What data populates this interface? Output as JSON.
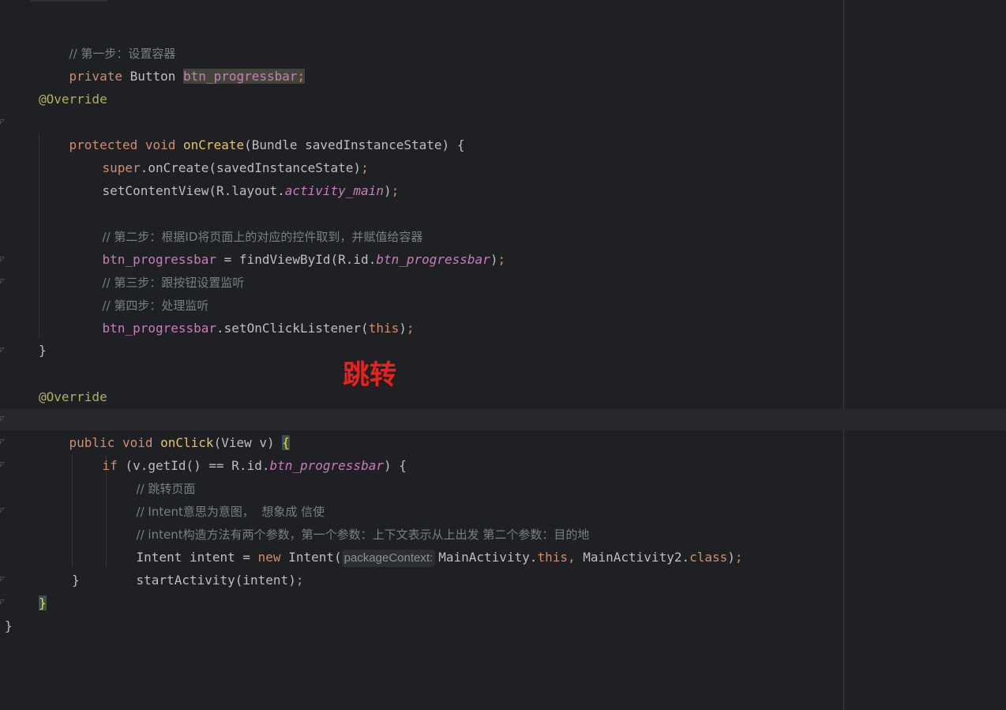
{
  "lines": [
    {
      "id": "c1",
      "text": "// 第一步：设置容器"
    },
    {
      "id": "l2a",
      "text": "private "
    },
    {
      "id": "l2b",
      "text": "Button "
    },
    {
      "id": "l2c",
      "text": "btn_progressbar"
    },
    {
      "id": "l2d",
      "text": ";"
    },
    {
      "id": "l4",
      "text": "@Override"
    },
    {
      "id": "l5a",
      "text": "protected void "
    },
    {
      "id": "l5b",
      "text": "onCreate"
    },
    {
      "id": "l5c",
      "text": "(Bundle savedInstanceState) {"
    },
    {
      "id": "l6a",
      "text": "super"
    },
    {
      "id": "l6b",
      "text": ".onCreate(savedInstanceState)"
    },
    {
      "id": "l6c",
      "text": ";"
    },
    {
      "id": "l7a",
      "text": "setContentView(R.layout."
    },
    {
      "id": "l7b",
      "text": "activity_main"
    },
    {
      "id": "l7c",
      "text": ")"
    },
    {
      "id": "l7d",
      "text": ";"
    },
    {
      "id": "c2",
      "text": "// 第二步：根据ID将页面上的对应的控件取到，并赋值给容器"
    },
    {
      "id": "l10a",
      "text": "btn_progressbar"
    },
    {
      "id": "l10b",
      "text": " = findViewById(R.id."
    },
    {
      "id": "l10c",
      "text": "btn_progressbar"
    },
    {
      "id": "l10d",
      "text": ")"
    },
    {
      "id": "l10e",
      "text": ";"
    },
    {
      "id": "c3",
      "text": "// 第三步：跟按钮设置监听"
    },
    {
      "id": "c4",
      "text": "// 第四步：处理监听"
    },
    {
      "id": "l13a",
      "text": "btn_progressbar"
    },
    {
      "id": "l13b",
      "text": ".setOnClickListener("
    },
    {
      "id": "l13c",
      "text": "this"
    },
    {
      "id": "l13d",
      "text": ")"
    },
    {
      "id": "l13e",
      "text": ";"
    },
    {
      "id": "l15",
      "text": "}"
    },
    {
      "id": "l17",
      "text": "@Override"
    },
    {
      "id": "l18a",
      "text": "public void "
    },
    {
      "id": "l18b",
      "text": "onClick"
    },
    {
      "id": "l18c",
      "text": "(View v) "
    },
    {
      "id": "l18d",
      "text": "{"
    },
    {
      "id": "l19a",
      "text": "if "
    },
    {
      "id": "l19b",
      "text": "(v.getId() == R.id."
    },
    {
      "id": "l19c",
      "text": "btn_progressbar"
    },
    {
      "id": "l19d",
      "text": ") {"
    },
    {
      "id": "c5",
      "text": "// 跳转页面"
    },
    {
      "id": "c6",
      "text": "// Intent意思为意图，  想象成 信使"
    },
    {
      "id": "c7",
      "text": "// intent构造方法有两个参数，第一个参数：上下文表示从上出发 第二个参数：目的地"
    },
    {
      "id": "l23a",
      "text": "Intent intent = "
    },
    {
      "id": "l23b",
      "text": "new "
    },
    {
      "id": "l23c",
      "text": "Intent("
    },
    {
      "id": "l23hint",
      "text": "packageContext:"
    },
    {
      "id": "l23d",
      "text": "MainActivity."
    },
    {
      "id": "l23e",
      "text": "this, "
    },
    {
      "id": "l23f",
      "text": "MainActivity2."
    },
    {
      "id": "l23g",
      "text": "class"
    },
    {
      "id": "l23h",
      "text": ")"
    },
    {
      "id": "l23i",
      "text": ";"
    },
    {
      "id": "l24a",
      "text": "startActivity(intent)"
    },
    {
      "id": "l24b",
      "text": ";"
    },
    {
      "id": "l25",
      "text": "}"
    },
    {
      "id": "l26",
      "text": "}"
    },
    {
      "id": "l27",
      "text": "}"
    }
  ],
  "overlay_label": "跳转",
  "colors": {
    "background": "#1f2023",
    "keyword": "#cf8e6d",
    "function": "#56a8f5",
    "annotation": "#b3ae60",
    "field": "#c77dbb",
    "comment": "#7a7e85",
    "overlay_red": "#e8221e"
  }
}
